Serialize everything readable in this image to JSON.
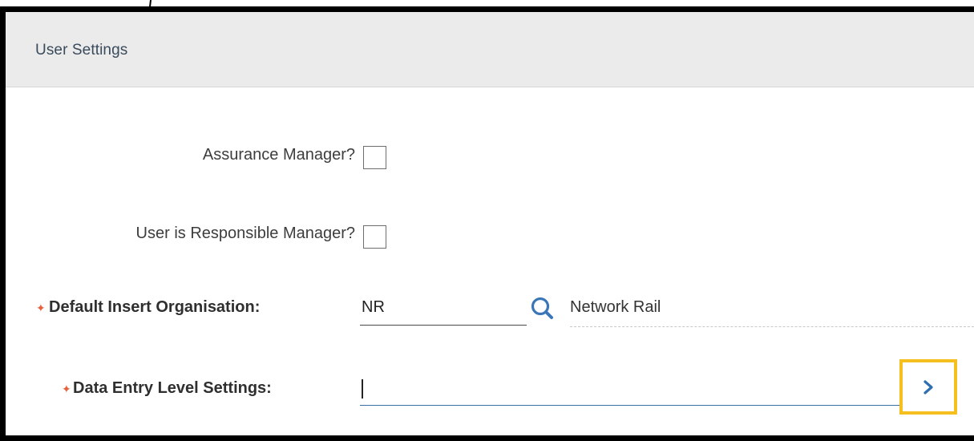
{
  "section": {
    "title": "User Settings"
  },
  "fields": {
    "assurance_manager": {
      "label": "Assurance Manager?",
      "checked": false
    },
    "responsible_manager": {
      "label": "User is Responsible Manager?",
      "checked": false
    },
    "default_org": {
      "label": "Default Insert Organisation:",
      "value": "NR",
      "description": "Network Rail",
      "required": true,
      "lookup_icon": "search-icon"
    },
    "data_entry_level": {
      "label": "Data Entry Level Settings:",
      "value": "",
      "required": true,
      "action_icon": "chevron-right-icon"
    }
  },
  "colors": {
    "required_marker": "#e8603c",
    "highlight_box": "#f5bf1f",
    "link_blue": "#3b6ea5",
    "header_bg": "#ebebeb"
  }
}
